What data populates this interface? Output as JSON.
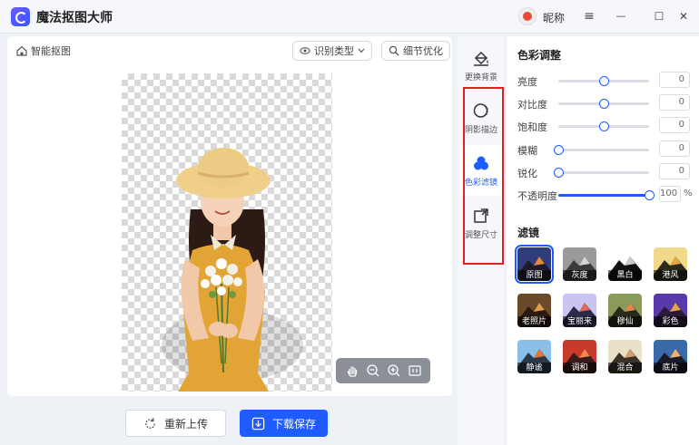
{
  "app": {
    "title": "魔法抠图大师",
    "nickname": "昵称"
  },
  "window_controls": {
    "menu": "≡",
    "minimize": "—",
    "maximize": "☐",
    "close": "✕"
  },
  "toolbar": {
    "smart_cut_label": "智能抠图",
    "recognize_type_label": "识别类型",
    "detail_optimize_label": "细节优化"
  },
  "actions": {
    "reupload_label": "重新上传",
    "download_label": "下载保存"
  },
  "tools": [
    {
      "label": "更换背景",
      "icon": "paint-bucket-icon",
      "active": false
    },
    {
      "label": "阴影描边",
      "icon": "shadow-circle-icon",
      "active": false
    },
    {
      "label": "色彩滤镜",
      "icon": "color-filter-icon",
      "active": true
    },
    {
      "label": "调整尺寸",
      "icon": "resize-icon",
      "active": false
    }
  ],
  "color_adjust": {
    "title": "色彩调整",
    "sliders": [
      {
        "label": "亮度",
        "value": "0",
        "level": 0.5
      },
      {
        "label": "对比度",
        "value": "0",
        "level": 0.5
      },
      {
        "label": "饱和度",
        "value": "0",
        "level": 0.5
      },
      {
        "label": "模糊",
        "value": "0",
        "level": 0.0
      },
      {
        "label": "锐化",
        "value": "0",
        "level": 0.0
      },
      {
        "label": "不透明度",
        "value": "100",
        "unit": "%",
        "level": 1.0
      }
    ]
  },
  "filters": {
    "title": "滤镜",
    "items": [
      {
        "label": "原图",
        "active": true
      },
      {
        "label": "灰度",
        "active": false
      },
      {
        "label": "黑白",
        "active": false
      },
      {
        "label": "港风",
        "active": false
      },
      {
        "label": "老照片",
        "active": false
      },
      {
        "label": "宝丽来",
        "active": false
      },
      {
        "label": "穆仙",
        "active": false
      },
      {
        "label": "彩色",
        "active": false
      },
      {
        "label": "静谧",
        "active": false
      },
      {
        "label": "调和",
        "active": false
      },
      {
        "label": "混合",
        "active": false
      },
      {
        "label": "底片",
        "active": false
      }
    ]
  },
  "colors": {
    "accent": "#1f5cff",
    "highlight_box": "#e02020"
  }
}
